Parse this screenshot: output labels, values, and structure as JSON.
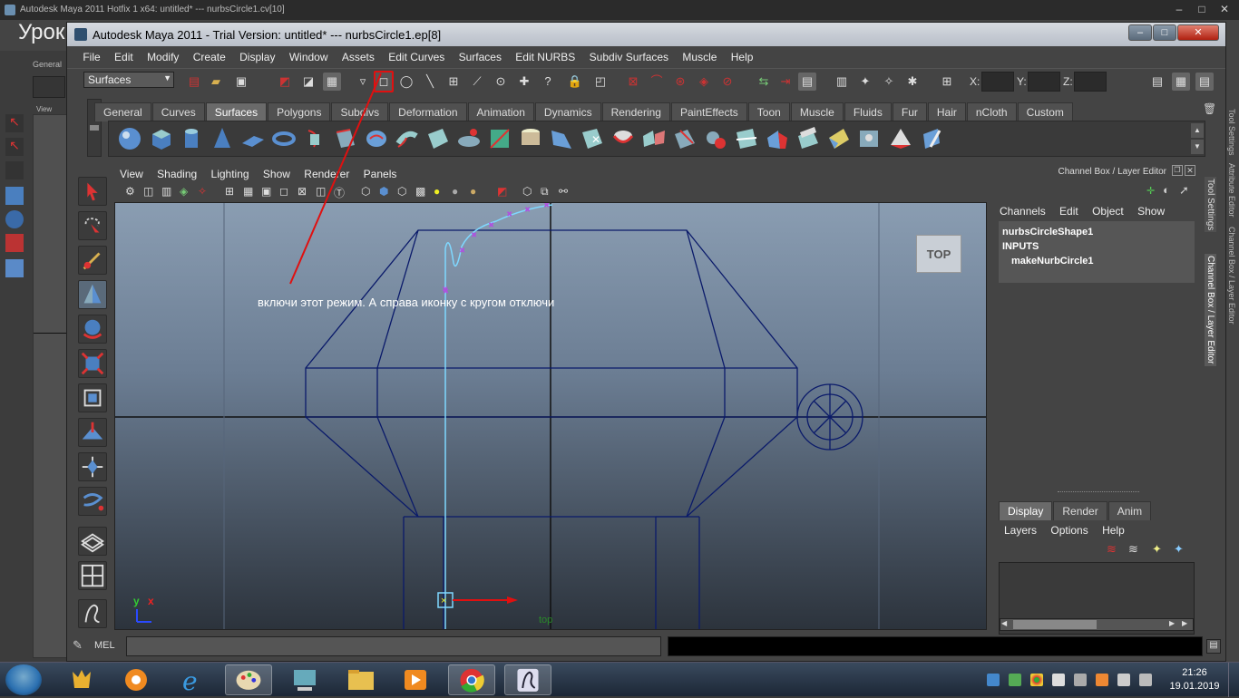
{
  "bg_window": {
    "title": "Autodesk Maya 2011 Hotfix 1 x64: untitled*  ---  nurbsCircle1.cv[10]",
    "logo_text": "Урок",
    "left_labels": [
      "General",
      "View"
    ]
  },
  "window": {
    "title": "Autodesk Maya 2011 - Trial Version: untitled*   ---   nurbsCircle1.ep[8]",
    "controls": [
      "–",
      "□",
      "✕"
    ]
  },
  "menubar": [
    "File",
    "Edit",
    "Modify",
    "Create",
    "Display",
    "Window",
    "Assets",
    "Edit Curves",
    "Surfaces",
    "Edit NURBS",
    "Subdiv Surfaces",
    "Muscle",
    "Help"
  ],
  "status_line": {
    "mode": "Surfaces",
    "x_label": "X:",
    "y_label": "Y:",
    "z_label": "Z:",
    "x_value": "",
    "y_value": "",
    "z_value": ""
  },
  "shelf": {
    "tabs": [
      "General",
      "Curves",
      "Surfaces",
      "Polygons",
      "Subdivs",
      "Deformation",
      "Animation",
      "Dynamics",
      "Rendering",
      "PaintEffects",
      "Toon",
      "Muscle",
      "Fluids",
      "Fur",
      "Hair",
      "nCloth",
      "Custom"
    ],
    "active_tab": "Surfaces"
  },
  "viewport": {
    "menu": [
      "View",
      "Shading",
      "Lighting",
      "Show",
      "Renderer",
      "Panels"
    ],
    "view_cube": "TOP",
    "camera_label": "top",
    "axis_y": "y",
    "axis_x": "x",
    "annotation": "включи этот режим.  А справа иконку с кругом отключи"
  },
  "channel_box": {
    "title": "Channel Box / Layer Editor",
    "menu": [
      "Channels",
      "Edit",
      "Object",
      "Show"
    ],
    "items": [
      "nurbsCircleShape1",
      "INPUTS",
      "makeNurbCircle1"
    ],
    "layer_tabs": [
      "Display",
      "Render",
      "Anim"
    ],
    "layer_active": "Display",
    "layer_menu": [
      "Layers",
      "Options",
      "Help"
    ],
    "side_tabs": [
      "Tool Settings",
      "Channel Box / Layer Editor"
    ],
    "outer_side_tabs": [
      "Tool Settings",
      "Attribute Editor",
      "Channel Box / Layer Editor"
    ]
  },
  "command_line": {
    "label": "MEL",
    "input": "",
    "output": ""
  },
  "taskbar": {
    "time": "21:26",
    "date": "19.01.2019"
  },
  "colors": {
    "wire": "#0a1a6a",
    "curve": "#7fd8ff",
    "annotation_arrow": "#e01010",
    "highlight_box": "#e01010"
  }
}
